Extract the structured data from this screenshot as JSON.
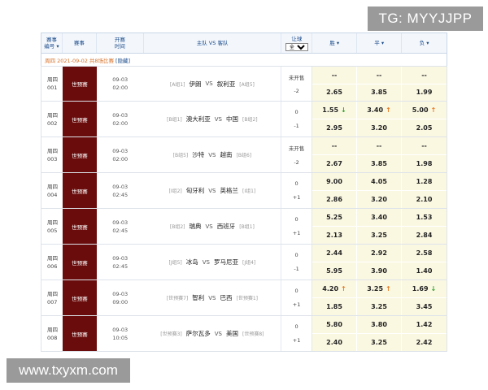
{
  "watermarks": {
    "top": "TG: MYYJJPP",
    "bottom": "www.txyxm.com"
  },
  "header": {
    "id": "赛事\n编号",
    "match": "赛事",
    "time": "开赛\n时间",
    "teams": "主队 VS 客队",
    "handicap": "让球",
    "handicap_select": "全部",
    "win": "胜 ▾",
    "draw": "平 ▾",
    "lose": "负 ▾"
  },
  "day": {
    "date": "周四 2021-09-02",
    "count": "共8场比赛",
    "hide": "[隐藏]"
  },
  "rows": [
    {
      "id1": "周四",
      "id2": "001",
      "league": "世预赛",
      "date": "09-03",
      "time": "02:00",
      "home_grp": "[A组1]",
      "home": "伊朗",
      "away": "叙利亚",
      "away_grp": "[A组5]",
      "hcp1": "未开售",
      "hcp2": "-2",
      "o1": [
        "--",
        "--",
        "--"
      ],
      "o2": [
        "2.65",
        "3.85",
        "1.99"
      ],
      "a1": [
        "",
        "",
        ""
      ],
      "a2": [
        "",
        "",
        ""
      ]
    },
    {
      "id1": "周四",
      "id2": "002",
      "league": "世预赛",
      "date": "09-03",
      "time": "02:00",
      "home_grp": "[B组1]",
      "home": "澳大利亚",
      "away": "中国",
      "away_grp": "[B组2]",
      "hcp1": "0",
      "hcp2": "-1",
      "o1": [
        "1.55",
        "3.40",
        "5.00"
      ],
      "o2": [
        "2.95",
        "3.20",
        "2.05"
      ],
      "a1": [
        "down",
        "up",
        "up"
      ],
      "a2": [
        "",
        "",
        ""
      ]
    },
    {
      "id1": "周四",
      "id2": "003",
      "league": "世预赛",
      "date": "09-03",
      "time": "02:00",
      "home_grp": "[B组5]",
      "home": "沙特",
      "away": "越南",
      "away_grp": "[B组6]",
      "hcp1": "未开售",
      "hcp2": "-2",
      "o1": [
        "--",
        "--",
        "--"
      ],
      "o2": [
        "2.67",
        "3.85",
        "1.98"
      ],
      "a1": [
        "",
        "",
        ""
      ],
      "a2": [
        "",
        "",
        ""
      ]
    },
    {
      "id1": "周四",
      "id2": "004",
      "league": "世预赛",
      "date": "09-03",
      "time": "02:45",
      "home_grp": "[I组2]",
      "home": "匈牙利",
      "away": "英格兰",
      "away_grp": "[I组1]",
      "hcp1": "0",
      "hcp2": "+1",
      "o1": [
        "9.00",
        "4.05",
        "1.28"
      ],
      "o2": [
        "2.86",
        "3.20",
        "2.10"
      ],
      "a1": [
        "",
        "",
        ""
      ],
      "a2": [
        "",
        "",
        ""
      ]
    },
    {
      "id1": "周四",
      "id2": "005",
      "league": "世预赛",
      "date": "09-03",
      "time": "02:45",
      "home_grp": "[B组2]",
      "home": "瑞典",
      "away": "西班牙",
      "away_grp": "[B组1]",
      "hcp1": "0",
      "hcp2": "+1",
      "o1": [
        "5.25",
        "3.40",
        "1.53"
      ],
      "o2": [
        "2.13",
        "3.25",
        "2.84"
      ],
      "a1": [
        "",
        "",
        ""
      ],
      "a2": [
        "",
        "",
        ""
      ]
    },
    {
      "id1": "周四",
      "id2": "006",
      "league": "世预赛",
      "date": "09-03",
      "time": "02:45",
      "home_grp": "[J组5]",
      "home": "冰岛",
      "away": "罗马尼亚",
      "away_grp": "[J组4]",
      "hcp1": "0",
      "hcp2": "-1",
      "o1": [
        "2.44",
        "2.92",
        "2.58"
      ],
      "o2": [
        "5.95",
        "3.90",
        "1.40"
      ],
      "a1": [
        "",
        "",
        ""
      ],
      "a2": [
        "",
        "",
        ""
      ]
    },
    {
      "id1": "周四",
      "id2": "007",
      "league": "世预赛",
      "date": "09-03",
      "time": "09:00",
      "home_grp": "[世预赛7]",
      "home": "智利",
      "away": "巴西",
      "away_grp": "[世预赛1]",
      "hcp1": "0",
      "hcp2": "+1",
      "o1": [
        "4.20",
        "3.25",
        "1.69"
      ],
      "o2": [
        "1.85",
        "3.25",
        "3.45"
      ],
      "a1": [
        "up",
        "up",
        "down"
      ],
      "a2": [
        "",
        "",
        ""
      ]
    },
    {
      "id1": "周四",
      "id2": "008",
      "league": "世预赛",
      "date": "09-03",
      "time": "10:05",
      "home_grp": "[世预赛3]",
      "home": "萨尔瓦多",
      "away": "美国",
      "away_grp": "[世预赛8]",
      "hcp1": "0",
      "hcp2": "+1",
      "o1": [
        "5.80",
        "3.80",
        "1.42"
      ],
      "o2": [
        "2.40",
        "3.25",
        "2.42"
      ],
      "a1": [
        "",
        "",
        ""
      ],
      "a2": [
        "",
        "",
        ""
      ]
    }
  ],
  "colors": {
    "league_bg": "#6a0c0c",
    "odds_bg": "#fbf8e2",
    "arrow_up": "#e8761e",
    "arrow_down": "#2aa12a",
    "header_text": "#1a4a8a"
  },
  "icons": {
    "up": "arrow-up-icon",
    "down": "arrow-down-icon"
  }
}
